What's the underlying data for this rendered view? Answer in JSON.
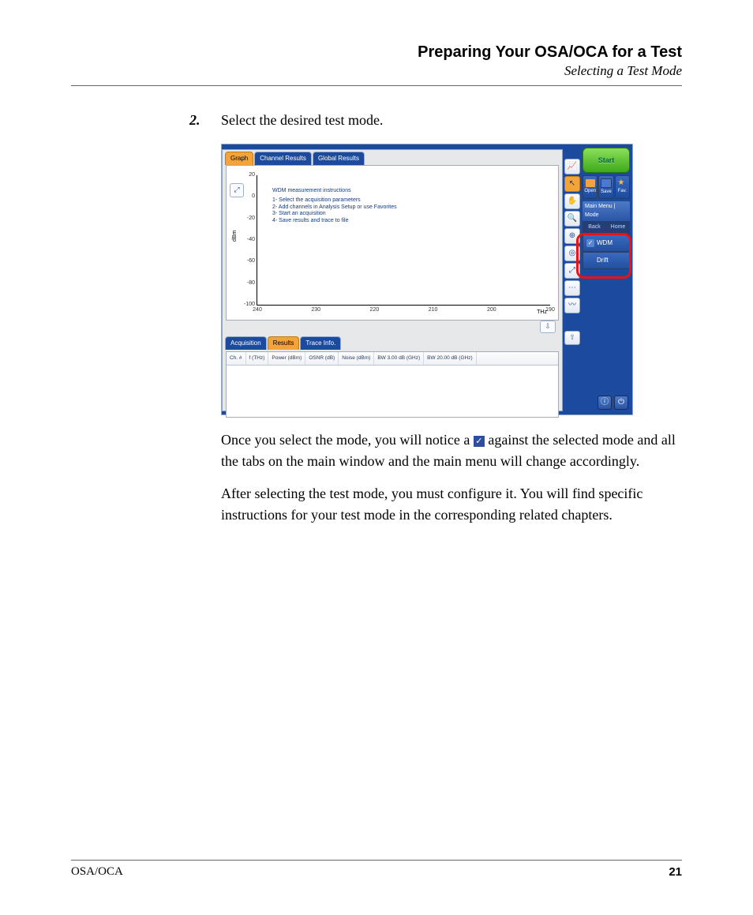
{
  "header": {
    "title": "Preparing Your OSA/OCA for a Test",
    "subtitle": "Selecting a Test Mode"
  },
  "step": {
    "number": "2.",
    "text": "Select the desired test mode."
  },
  "screenshot": {
    "top_tabs": [
      "Graph",
      "Channel Results",
      "Global Results"
    ],
    "bottom_tabs": [
      "Acquisition",
      "Results",
      "Trace Info."
    ],
    "instructions": {
      "title": "WDM measurement instructions",
      "lines": [
        "1- Select the acquisition parameters",
        "2- Add channels in Analysis Setup or use Favorites",
        "3- Start an acquisition",
        "4- Save results and trace to file"
      ]
    },
    "y_ticks": [
      "20",
      "0",
      "-20",
      "-40",
      "-60",
      "-80",
      "-100"
    ],
    "x_ticks": [
      "240",
      "230",
      "220",
      "210",
      "200",
      "190"
    ],
    "y_unit": "dBm",
    "x_unit": "THz",
    "table_headers": [
      "Ch. #",
      "f (THz)",
      "Power (dBm)",
      "OSNR (dB)",
      "Noise (dBm)",
      "BW 3.00 dB (GHz)",
      "BW 20.00 dB (GHz)"
    ],
    "side": {
      "start": "Start",
      "file": {
        "open": "Open",
        "save": "Save",
        "fav": "Fav."
      },
      "menu_header": "Main Menu | Mode",
      "nav": {
        "back": "Back",
        "home": "Home"
      },
      "modes": [
        {
          "label": "WDM",
          "checked": true
        },
        {
          "label": "Drift",
          "checked": false
        }
      ]
    }
  },
  "body": {
    "p1a": "Once you select the mode, you will notice a ",
    "p1b": " against the selected mode and all the tabs on the main window and the main menu will change accordingly.",
    "p2": "After selecting the test mode, you must configure it. You will find specific instructions for your test mode in the corresponding related chapters."
  },
  "footer": {
    "left": "OSA/OCA",
    "right": "21"
  },
  "chart_data": {
    "type": "line",
    "title": "WDM measurement instructions",
    "xlabel": "THz",
    "ylabel": "dBm",
    "xlim": [
      190,
      240
    ],
    "ylim": [
      -100,
      20
    ],
    "series": []
  }
}
